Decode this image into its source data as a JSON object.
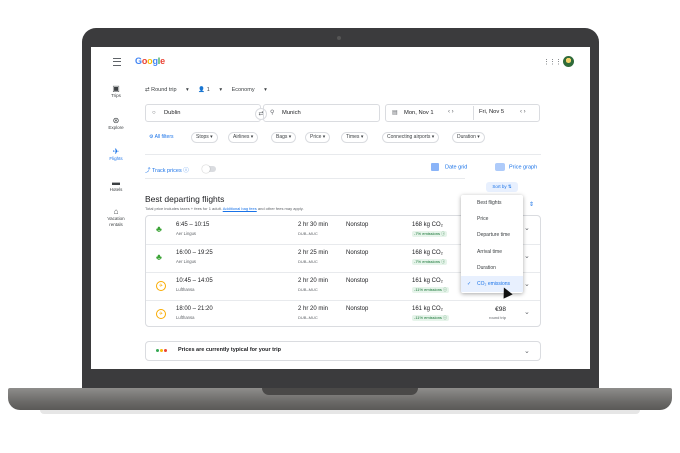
{
  "app": {
    "logo": "Google",
    "brand_colors": [
      "#4285f4",
      "#ea4335",
      "#fbbc05",
      "#34a853"
    ]
  },
  "nav": {
    "items": [
      {
        "label": "Trips",
        "icon": "suitcase-icon",
        "glyph": "🧳"
      },
      {
        "label": "Explore",
        "icon": "explore-icon",
        "glyph": "⊛"
      },
      {
        "label": "Flights",
        "icon": "airplane-icon",
        "glyph": "✈"
      },
      {
        "label": "Hotels",
        "icon": "bed-icon",
        "glyph": "🛏"
      },
      {
        "label": "Vacation rentals",
        "icon": "house-icon",
        "glyph": "⌂"
      }
    ]
  },
  "search": {
    "trip_type": "Round trip",
    "passengers": "1",
    "cabin": "Economy",
    "origin": "Dublin",
    "destination": "Munich",
    "depart_date": "Mon, Nov 1",
    "return_date": "Fri, Nov 5"
  },
  "filters": {
    "all_filters": "All filters",
    "chips": [
      "Stops",
      "Airlines",
      "Bags",
      "Price",
      "Times",
      "Connecting airports",
      "Duration"
    ]
  },
  "tools": {
    "track_prices": "Track prices",
    "date_grid": "Date grid",
    "price_graph": "Price graph"
  },
  "results": {
    "title": "Best departing flights",
    "subtitle_prefix": "Total price includes taxes + fees for 1 adult.",
    "subtitle_link": "Additional bag fees",
    "subtitle_suffix": "and other fees may apply.",
    "flights": [
      {
        "time": "6:45 – 10:15",
        "airline": "Aer Lingus",
        "duration": "2 hr 30 min",
        "route": "DUB–MUC",
        "stops": "Nonstop",
        "co2": "168 kg CO₂",
        "emissions": "-7% emissions",
        "price": "",
        "price_type": "",
        "logo": "shamrock"
      },
      {
        "time": "16:00 – 19:25",
        "airline": "Aer Lingus",
        "duration": "2 hr 25 min",
        "route": "DUB–MUC",
        "stops": "Nonstop",
        "co2": "168 kg CO₂",
        "emissions": "-7% emissions",
        "price": "",
        "price_type": "",
        "logo": "shamrock"
      },
      {
        "time": "10:45 – 14:05",
        "airline": "Lufthansa",
        "duration": "2 hr 20 min",
        "route": "DUB–MUC",
        "stops": "Nonstop",
        "co2": "161 kg CO₂",
        "emissions": "-11% emissions",
        "price": "",
        "price_type": "",
        "logo": "lh"
      },
      {
        "time": "18:00 – 21:20",
        "airline": "Lufthansa",
        "duration": "2 hr 20 min",
        "route": "DUB–MUC",
        "stops": "Nonstop",
        "co2": "161 kg CO₂",
        "emissions": "-11% emissions",
        "price": "€98",
        "price_type": "round trip",
        "logo": "lh"
      }
    ]
  },
  "sort": {
    "label": "Sort by",
    "options": [
      "Best flights",
      "Price",
      "Departure time",
      "Arrival time",
      "Duration",
      "CO₂ emissions"
    ],
    "selected": "CO₂ emissions"
  },
  "insight": {
    "text": "Prices are currently typical for your trip"
  }
}
